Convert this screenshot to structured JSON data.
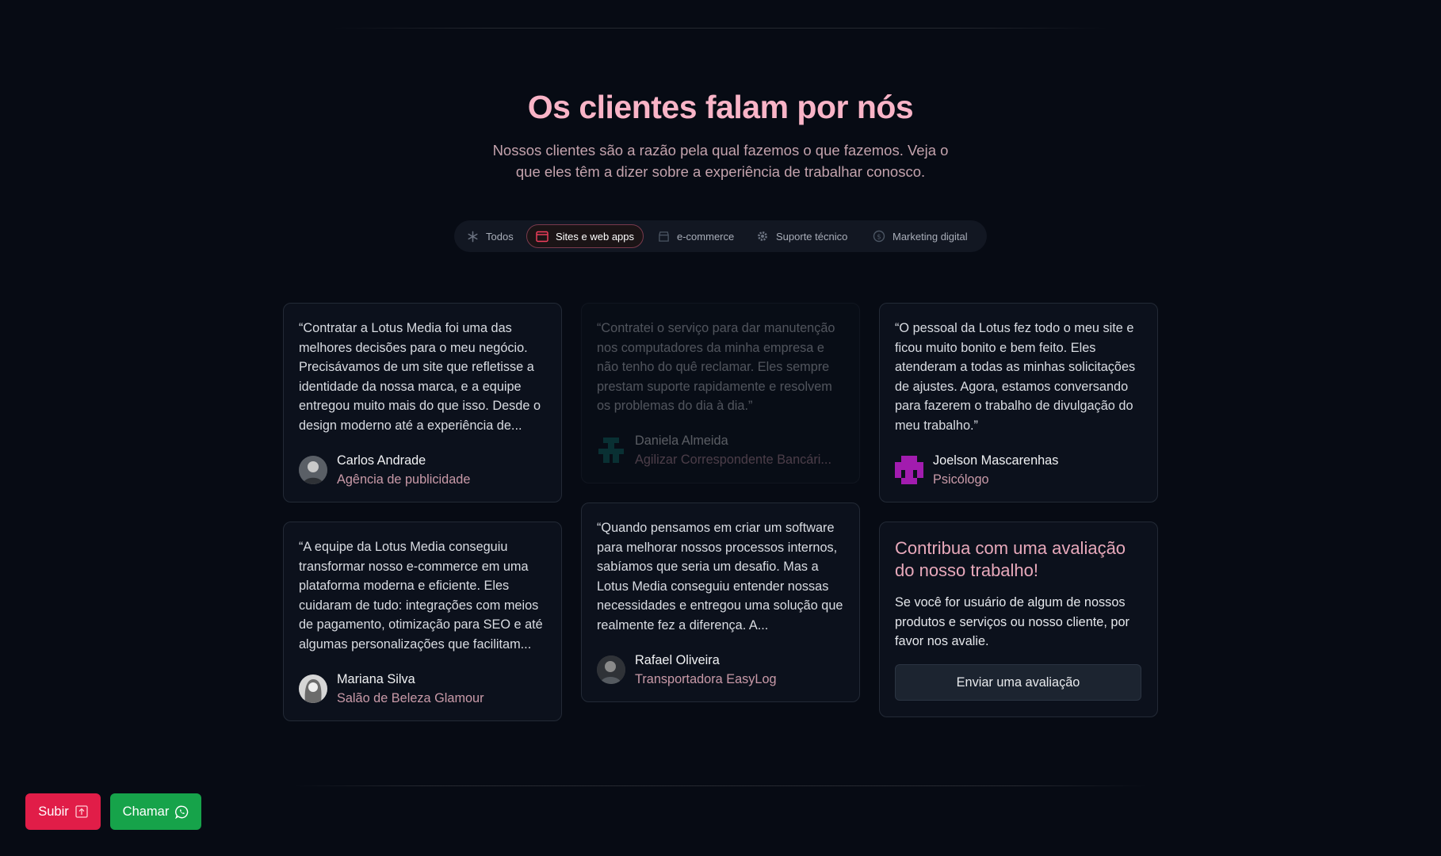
{
  "header": {
    "title": "Os clientes falam por nós",
    "subtitle": "Nossos clientes são a razão pela qual fazemos o que fazemos. Veja o que eles têm a dizer sobre a experiência de trabalhar conosco."
  },
  "tabs": [
    {
      "label": "Todos",
      "icon": "asterisk-icon"
    },
    {
      "label": "Sites e web apps",
      "icon": "browser-window-icon",
      "active": true
    },
    {
      "label": "e-commerce",
      "icon": "store-icon"
    },
    {
      "label": "Suporte técnico",
      "icon": "gear-icon"
    },
    {
      "label": "Marketing digital",
      "icon": "dollar-circle-icon"
    }
  ],
  "testimonials": [
    {
      "quote": "“Contratar a Lotus Media foi uma das melhores decisões para o meu negócio. Precisávamos de um site que refletisse a identidade da nossa marca, e a equipe entregou muito mais do que isso. Desde o design moderno até a experiência de...",
      "name": "Carlos Andrade",
      "role": "Agência de publicidade"
    },
    {
      "quote": "“Contratei o serviço para dar manutenção nos computadores da minha empresa e não tenho do quê reclamar. Eles sempre prestam suporte rapidamente e resolvem os problemas do dia à dia.”",
      "name": "Daniela Almeida",
      "role": "Agilizar Correspondente Bancári..."
    },
    {
      "quote": "“O pessoal da Lotus fez todo o meu site e ficou muito bonito e bem feito. Eles atenderam a todas as minhas solicitações de ajustes. Agora, estamos conversando para fazerem o trabalho de divulgação do meu trabalho.”",
      "name": "Joelson Mascarenhas",
      "role": "Psicólogo"
    },
    {
      "quote": "“A equipe da Lotus Media conseguiu transformar nosso e-commerce em uma plataforma moderna e eficiente. Eles cuidaram de tudo: integrações com meios de pagamento, otimização para SEO e até algumas personalizações que facilitam...",
      "name": "Mariana Silva",
      "role": "Salão de Beleza Glamour"
    },
    {
      "quote": "“Quando pensamos em criar um software para melhorar nossos processos internos, sabíamos que seria um desafio. Mas a Lotus Media conseguiu entender nossas necessidades e entregou uma solução que realmente fez a diferença. A...",
      "name": "Rafael Oliveira",
      "role": "Transportadora EasyLog"
    }
  ],
  "cta": {
    "title": "Contribua com uma avaliação do nosso trabalho!",
    "text": "Se você for usuário de algum de nossos produtos e serviços ou nosso cliente, por favor nos avalie.",
    "button": "Enviar uma avaliação"
  },
  "floating": {
    "subir": "Subir",
    "chamar": "Chamar"
  },
  "colors": {
    "accent_pink": "#f9b4c7",
    "subir_red": "#e11d48",
    "chamar_green": "#16a34a",
    "background": "#070b14"
  }
}
